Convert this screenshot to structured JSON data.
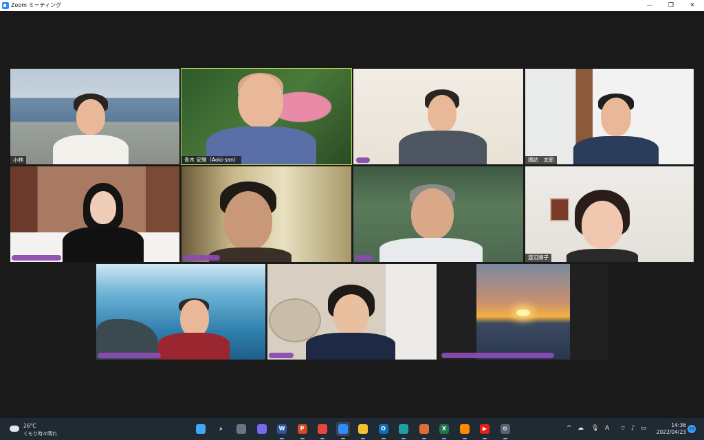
{
  "window": {
    "title": "Zoom ミーティング",
    "minimize": "—",
    "restore": "❐",
    "close": "✕"
  },
  "participants": [
    {
      "name": "小林",
      "redacted": false
    },
    {
      "name": "青木 安輝（Aoki-san）",
      "redacted": false,
      "speaking": true
    },
    {
      "name": "",
      "redacted": true
    },
    {
      "name": "諏訪　太郎",
      "redacted": false
    },
    {
      "name": "",
      "redacted": true
    },
    {
      "name": "",
      "redacted": true
    },
    {
      "name": "",
      "redacted": true
    },
    {
      "name": "渡辺順子",
      "redacted": false
    },
    {
      "name": "",
      "redacted": true
    },
    {
      "name": "",
      "redacted": true
    },
    {
      "name": "",
      "redacted": true
    }
  ],
  "taskbar": {
    "weather": {
      "temp": "26°C",
      "condition": "くもり時々晴れ",
      "icon": "partly-cloudy-icon"
    },
    "apps": [
      {
        "name": "start-button-icon",
        "glyph": "",
        "color": "#3fa9f5"
      },
      {
        "name": "search-icon",
        "glyph": "⌕",
        "color": "#202a33"
      },
      {
        "name": "task-view-icon",
        "glyph": "",
        "color": "#6b7580"
      },
      {
        "name": "teams-chat-icon",
        "glyph": "",
        "color": "#7b68ee"
      },
      {
        "name": "word-icon",
        "glyph": "W",
        "color": "#2b579a"
      },
      {
        "name": "powerpoint-icon",
        "glyph": "P",
        "color": "#d24726"
      },
      {
        "name": "chrome-icon",
        "glyph": "",
        "color": "#e8453c"
      },
      {
        "name": "zoom-icon",
        "glyph": "",
        "color": "#2d8cff"
      },
      {
        "name": "file-explorer-icon",
        "glyph": "",
        "color": "#f2c230"
      },
      {
        "name": "outlook-icon",
        "glyph": "O",
        "color": "#0f6cbd"
      },
      {
        "name": "edge-icon",
        "glyph": "",
        "color": "#1fa0a0"
      },
      {
        "name": "ms-store-icon",
        "glyph": "",
        "color": "#e06c3a"
      },
      {
        "name": "excel-icon",
        "glyph": "X",
        "color": "#217346"
      },
      {
        "name": "sublime-icon",
        "glyph": "",
        "color": "#ff8a00"
      },
      {
        "name": "youtube-icon",
        "glyph": "▶",
        "color": "#e62117"
      },
      {
        "name": "settings-icon",
        "glyph": "⚙",
        "color": "#5a6470"
      }
    ],
    "tray": {
      "chevron": "^",
      "ime": "A",
      "time": "14:36",
      "date": "2022/04/23",
      "notifications": "25"
    }
  }
}
